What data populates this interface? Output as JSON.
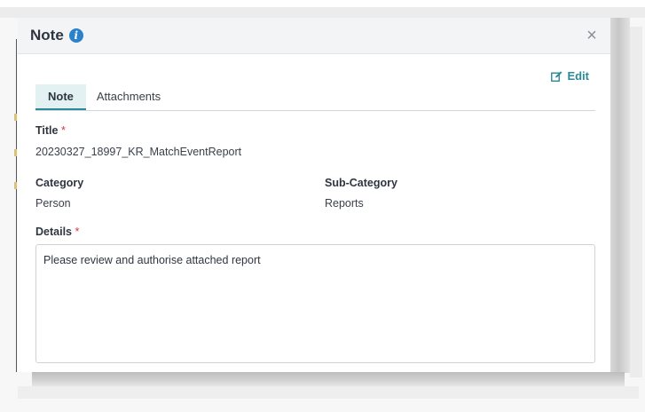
{
  "dialog": {
    "title": "Note",
    "close_glyph": "×",
    "edit_label": "Edit",
    "icons": {
      "info": "info-circle-icon",
      "edit": "edit-icon",
      "close": "close-icon"
    },
    "colors": {
      "accent": "#2a8a96",
      "info": "#2b82cb",
      "required": "#d9363e",
      "tab_active_bg": "#e4f1f3"
    }
  },
  "tabs": [
    {
      "label": "Note",
      "active": true
    },
    {
      "label": "Attachments",
      "active": false
    }
  ],
  "fields": {
    "title_label": "Title",
    "title_required_mark": "*",
    "title_value": "20230327_18997_KR_MatchEventReport",
    "category_label": "Category",
    "category_value": "Person",
    "subcategory_label": "Sub-Category",
    "subcategory_value": "Reports",
    "details_label": "Details",
    "details_required_mark": "*",
    "details_value": "Please review and authorise attached report"
  }
}
